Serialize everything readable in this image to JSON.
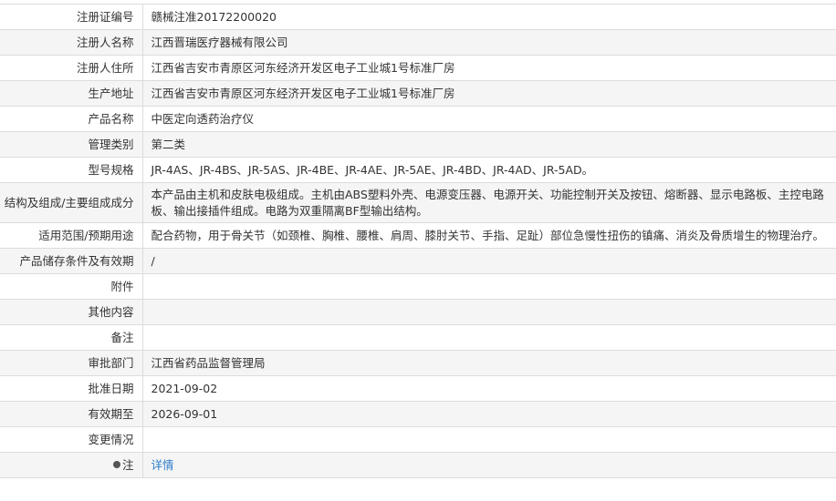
{
  "rows": [
    {
      "label": "注册证编号",
      "value": "赣械注准20172200020"
    },
    {
      "label": "注册人名称",
      "value": "江西晋瑞医疗器械有限公司"
    },
    {
      "label": "注册人住所",
      "value": "江西省吉安市青原区河东经济开发区电子工业城1号标准厂房"
    },
    {
      "label": "生产地址",
      "value": "江西省吉安市青原区河东经济开发区电子工业城1号标准厂房"
    },
    {
      "label": "产品名称",
      "value": "中医定向透药治疗仪"
    },
    {
      "label": "管理类别",
      "value": "第二类"
    },
    {
      "label": "型号规格",
      "value": "JR-4AS、JR-4BS、JR-5AS、JR-4BE、JR-4AE、JR-5AE、JR-4BD、JR-4AD、JR-5AD。"
    },
    {
      "label": "结构及组成/主要组成成分",
      "value": "本产品由主机和皮肤电极组成。主机由ABS塑料外壳、电源变压器、电源开关、功能控制开关及按钮、熔断器、显示电路板、主控电路板、输出接插件组成。电路为双重隔离BF型输出结构。"
    },
    {
      "label": "适用范围/预期用途",
      "value": "配合药物，用于骨关节（如颈椎、胸椎、腰椎、肩周、膝肘关节、手指、足趾）部位急慢性扭伤的镇痛、消炎及骨质增生的物理治疗。"
    },
    {
      "label": "产品储存条件及有效期",
      "value": "/"
    },
    {
      "label": "附件",
      "value": ""
    },
    {
      "label": "其他内容",
      "value": ""
    },
    {
      "label": "备注",
      "value": ""
    },
    {
      "label": "审批部门",
      "value": "江西省药品监督管理局"
    },
    {
      "label": "批准日期",
      "value": "2021-09-02"
    },
    {
      "label": "有效期至",
      "value": "2026-09-01"
    },
    {
      "label": "变更情况",
      "value": ""
    },
    {
      "label": "注",
      "value": "详情"
    }
  ]
}
